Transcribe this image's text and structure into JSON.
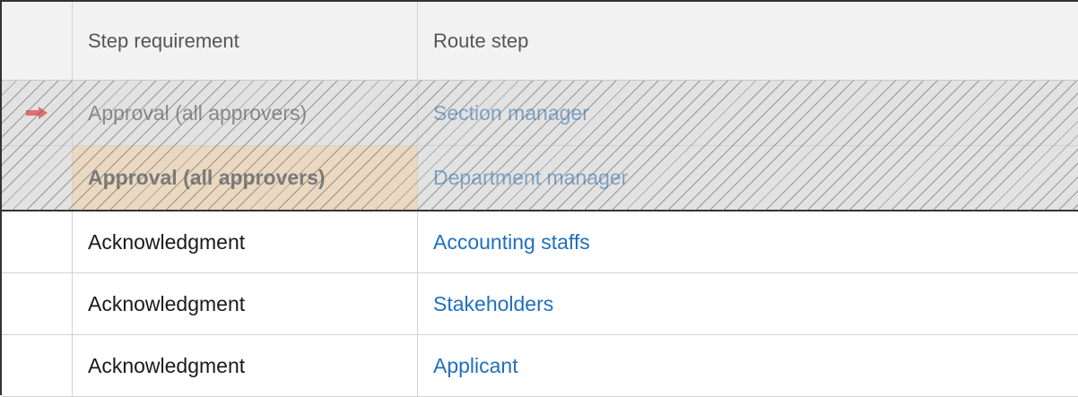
{
  "table": {
    "headers": {
      "marker": "",
      "requirement": "Step requirement",
      "route_step": "Route step"
    },
    "rows": [
      {
        "requirement": "Approval (all approvers)",
        "route_step": "Section manager",
        "state": "completed",
        "marker": "arrow-right-icon"
      },
      {
        "requirement": "Approval (all approvers)",
        "route_step": "Department manager",
        "state": "current"
      },
      {
        "requirement": "Acknowledgment",
        "route_step": "Accounting staffs",
        "state": "pending"
      },
      {
        "requirement": "Acknowledgment",
        "route_step": "Stakeholders",
        "state": "pending"
      },
      {
        "requirement": "Acknowledgment",
        "route_step": "Applicant",
        "state": "pending"
      }
    ]
  },
  "colors": {
    "link": "#1f6fbf",
    "arrow": "#e07070",
    "current_highlight": "#ead8c0"
  }
}
